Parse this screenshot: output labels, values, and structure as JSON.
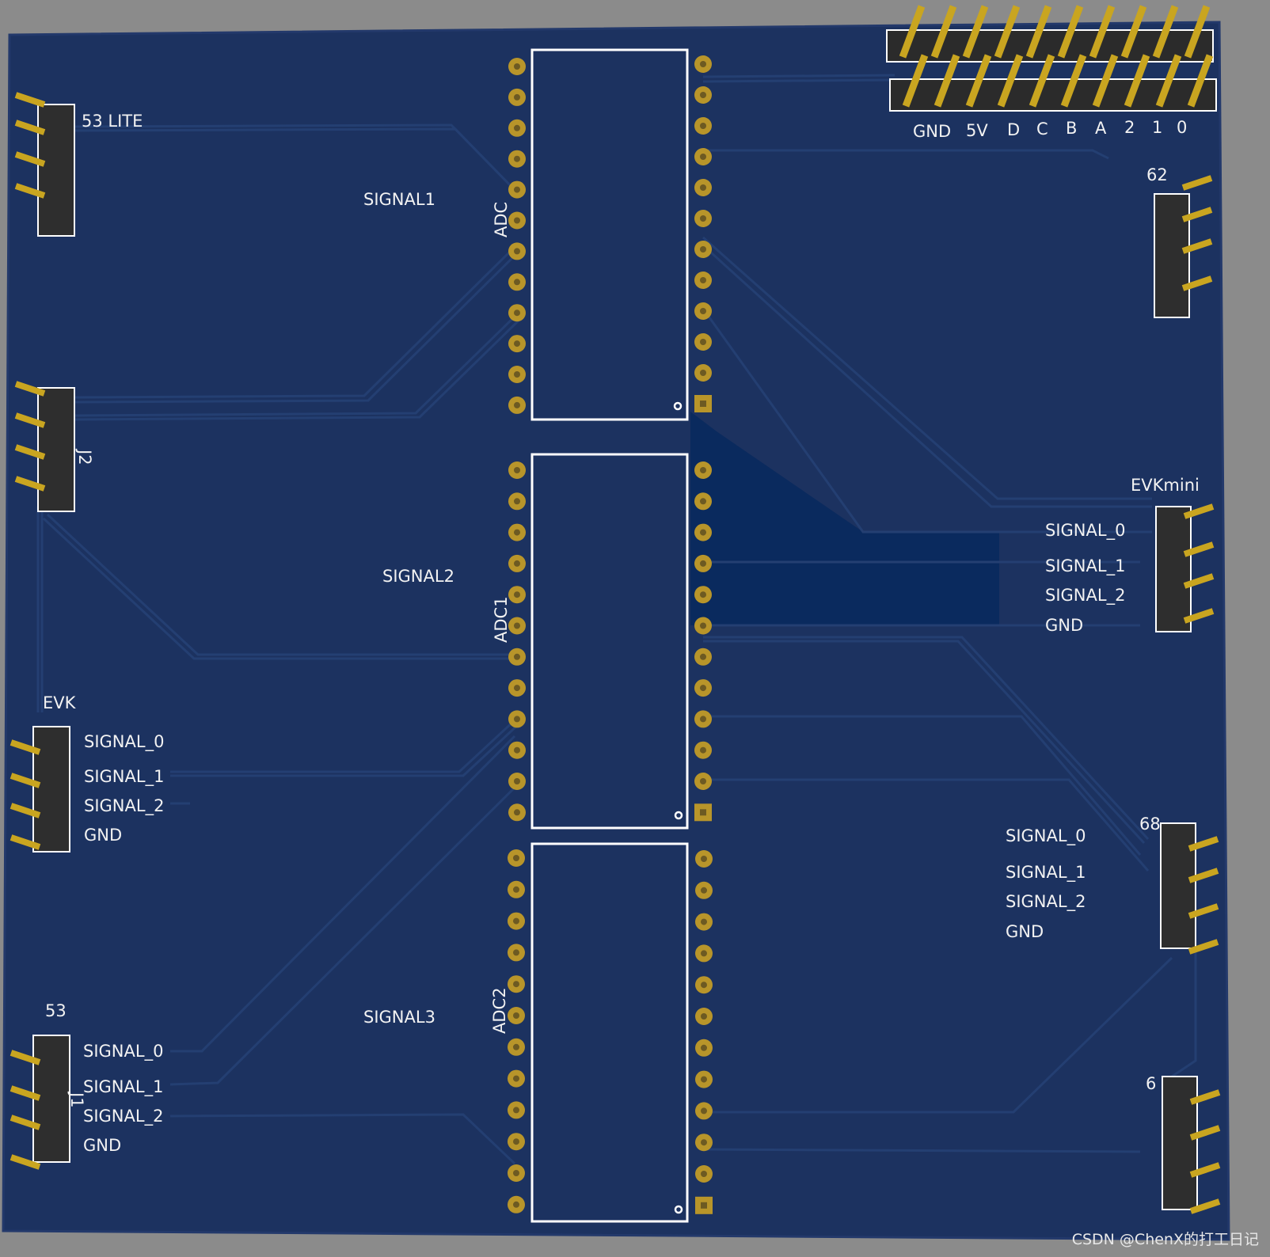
{
  "board": {
    "color": "#1c3260",
    "pour_color": "#0a2a5e",
    "trace_color": "#243f72",
    "silk_color": "#f2f2f2",
    "pad_color": "#b8952a"
  },
  "labels": {
    "lite53": "53 LITE",
    "signal1": "SIGNAL1",
    "signal2": "SIGNAL2",
    "signal3": "SIGNAL3",
    "adc": "ADC",
    "adc1": "ADC1",
    "adc2": "ADC2",
    "j2": "J2",
    "evk": "EVK",
    "evkmini": "EVKmini",
    "n53": "53",
    "n62": "62",
    "n68": "68",
    "n65": "6",
    "j1": "J1"
  },
  "header_pins": [
    "GND",
    "5V",
    "D",
    "C",
    "B",
    "A",
    "2",
    "1",
    "0"
  ],
  "evk_pins": [
    "SIGNAL_0",
    "SIGNAL_1",
    "SIGNAL_2",
    "GND"
  ],
  "evkmini_pins": [
    "SIGNAL_0",
    "SIGNAL_1",
    "SIGNAL_2",
    "GND"
  ],
  "c53_pins": [
    "SIGNAL_0",
    "SIGNAL_1",
    "SIGNAL_2",
    "GND"
  ],
  "c68_pins": [
    "SIGNAL_0",
    "SIGNAL_1",
    "SIGNAL_2",
    "GND"
  ],
  "watermark": "CSDN @ChenX的打工日记"
}
